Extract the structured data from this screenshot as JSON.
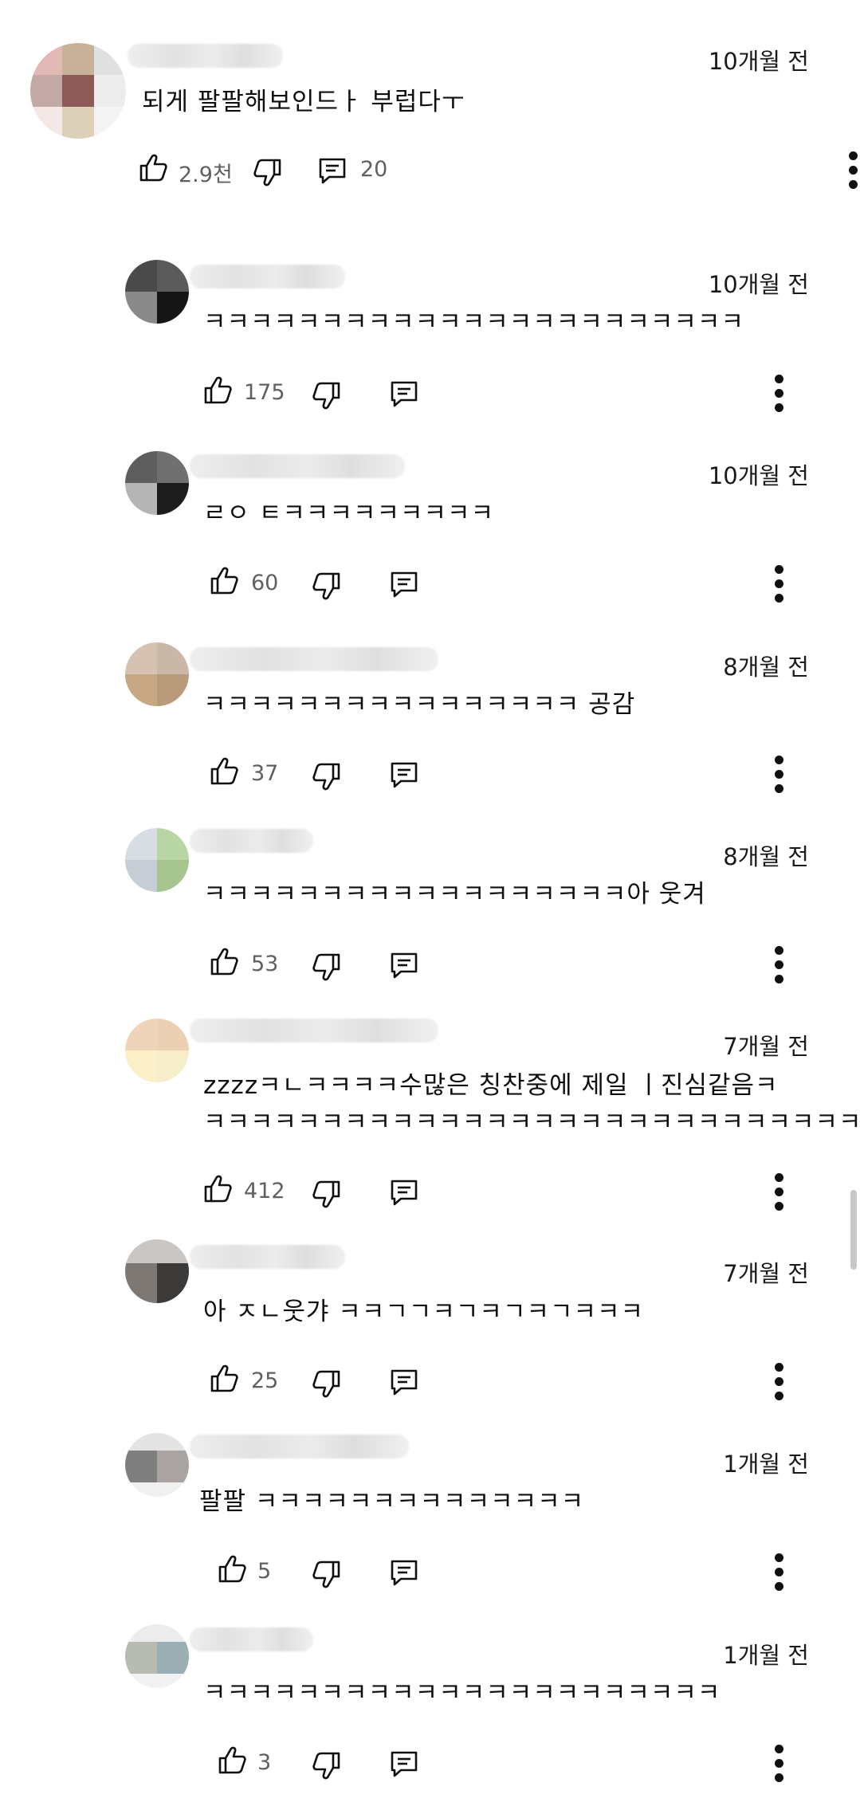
{
  "comments": [
    {
      "text": "되게 팔팔해보인드ㅏ 부럽다ㅜ",
      "time": "10개월 전",
      "likes": "2.9천",
      "replies": "20"
    },
    {
      "text": "ㅋㅋㅋㅋㅋㅋㅋㅋㅋㅋㅋㅋㅋㅋㅋㅋㅋㅋㅋㅋㅋㅋㅋ",
      "time": "10개월 전",
      "likes": "175"
    },
    {
      "text": "ㄹㅇ ㅌㅋㅋㅋㅋㅋㅋㅋㅋㅋ",
      "time": "10개월 전",
      "likes": "60"
    },
    {
      "text": "ㅋㅋㅋㅋㅋㅋㅋㅋㅋㅋㅋㅋㅋㅋㅋㅋ 공감",
      "time": "8개월 전",
      "likes": "37"
    },
    {
      "text": "ㅋㅋㅋㅋㅋㅋㅋㅋㅋㅋㅋㅋㅋㅋㅋㅋㅋㅋ아 웃겨",
      "time": "8개월 전",
      "likes": "53"
    },
    {
      "text": "zzzzㅋㄴㅋㅋㅋㅋ수많은 칭찬중에 제일 ㅣ진심같음ㅋ",
      "text2": "ㅋㅋㅋㅋㅋㅋㅋㅋㅋㅋㅋㅋㅋㅋㅋㅋㅋㅋㅋㅋㅋㅋㅋㅋㅋㅋㅋㅋㅋ",
      "time": "7개월 전",
      "likes": "412"
    },
    {
      "text": "아 ㅈㄴ웃갸 ㅋㅋㄱㄱㅋㄱㅋㄱㅋㄱㅋㅋㅋ",
      "time": "7개월 전",
      "likes": "25"
    },
    {
      "text": "팔팔 ㅋㅋㅋㅋㅋㅋㅋㅋㅋㅋㅋㅋㅋㅋ",
      "time": "1개월 전",
      "likes": "5"
    },
    {
      "text": "ㅋㅋㅋㅋㅋㅋㅋㅋㅋㅋㅋㅋㅋㅋㅋㅋㅋㅋㅋㅋㅋㅋ",
      "time": "1개월 전",
      "likes": "3"
    }
  ]
}
